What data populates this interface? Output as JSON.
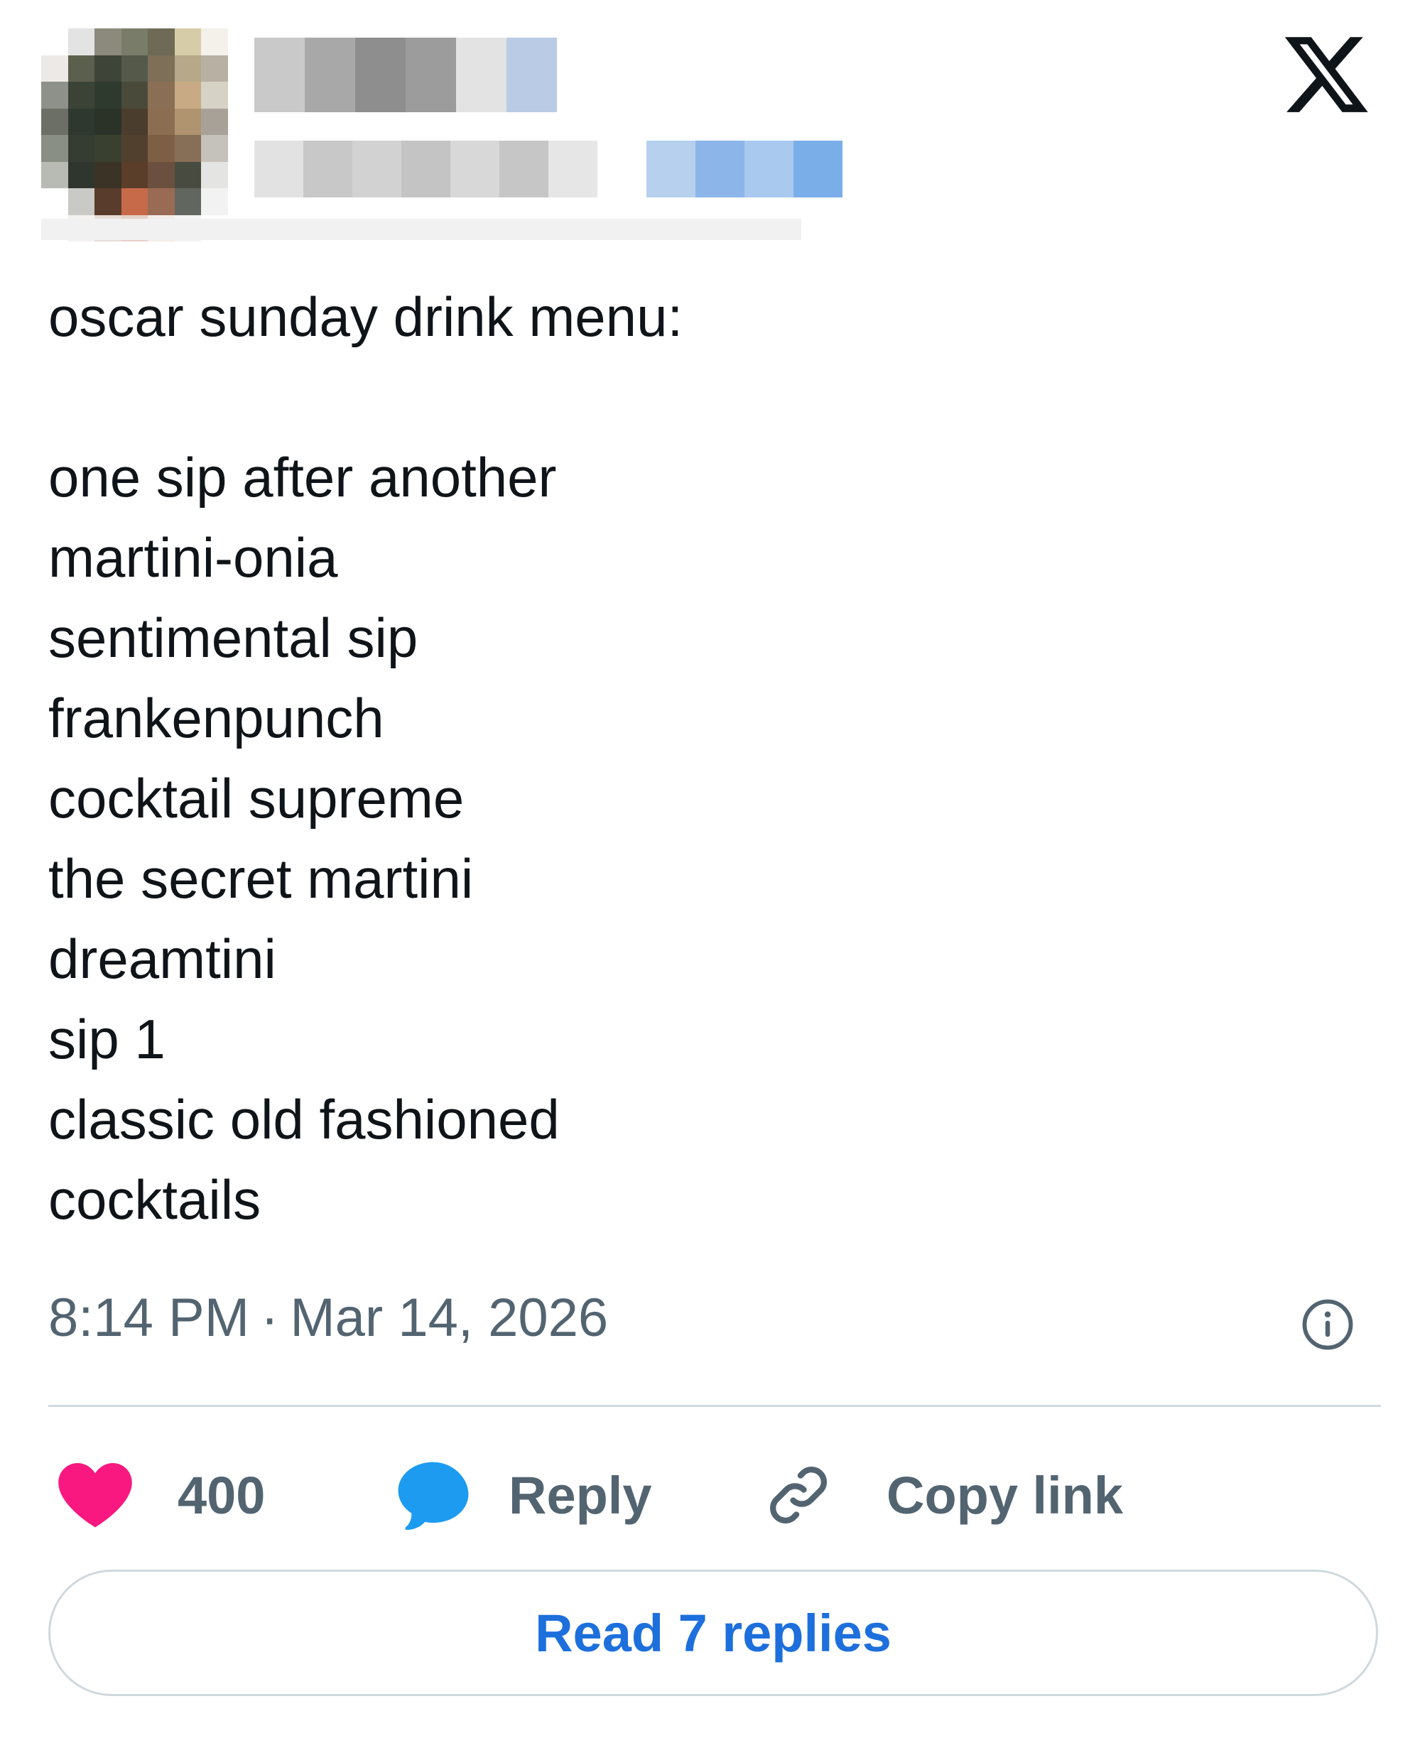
{
  "colors": {
    "text_primary": "#0f1419",
    "text_secondary": "#536471",
    "like_heart": "#f91880",
    "reply_bubble": "#1d9bf0",
    "link_blue": "#1d6fdc",
    "border": "#cfd9de"
  },
  "header": {
    "logo_icon": "x-logo-icon"
  },
  "post": {
    "intro": "oscar sunday drink menu:",
    "lines": [
      "one sip after another",
      "martini-onia",
      "sentimental sip",
      "frankenpunch",
      "cocktail supreme",
      "the secret martini",
      "dreamtini",
      "sip 1",
      "classic old fashioned",
      "cocktails"
    ]
  },
  "meta": {
    "time": "8:14 PM",
    "separator": "·",
    "date": "Mar 14, 2026",
    "info_icon": "info-icon"
  },
  "actions": {
    "like_icon": "heart-icon",
    "like_count": "400",
    "reply_icon": "speech-bubble-icon",
    "reply_label": "Reply",
    "copy_icon": "link-icon",
    "copy_label": "Copy link"
  },
  "read_replies_label": "Read 7 replies"
}
